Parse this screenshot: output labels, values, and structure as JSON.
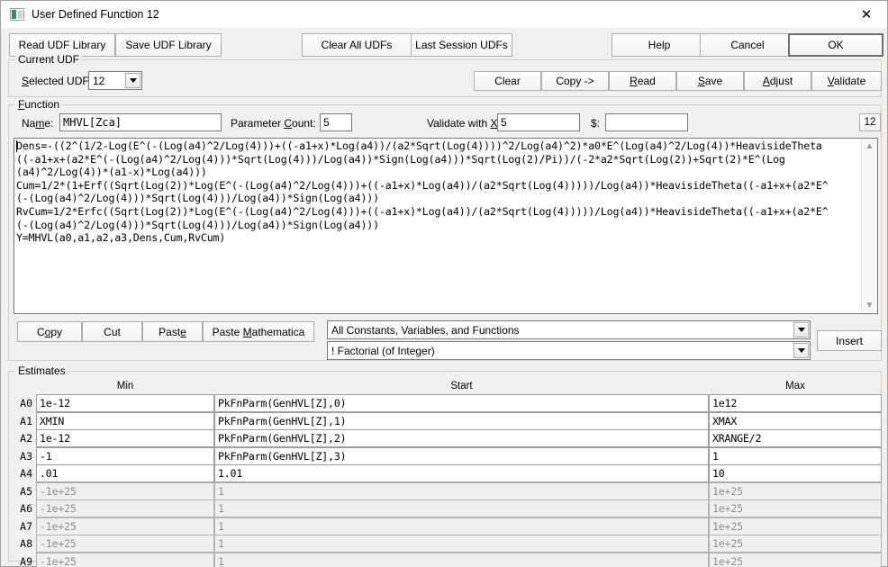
{
  "window": {
    "title": "User Defined Function 12",
    "icon": "app-icon",
    "close_label": "✕"
  },
  "toolbar": {
    "read_udf_library": "Read UDF Library",
    "save_udf_library": "Save UDF Library",
    "clear_all_udfs": "Clear All UDFs",
    "last_session_udfs": "Last Session UDFs",
    "help": "Help",
    "cancel": "Cancel",
    "ok": "OK"
  },
  "current_udf": {
    "legend": "Current UDF",
    "selected_label": "Selected UDF:",
    "selected_value": "12",
    "buttons": {
      "clear": "Clear",
      "copy_to": "Copy ->",
      "read": "Read",
      "save": "Save",
      "adjust": "Adjust",
      "validate": "Validate"
    }
  },
  "function": {
    "legend": "Function",
    "name_label": "Name:",
    "name_value": "MHVL[Zca]",
    "param_count_label": "Parameter Count:",
    "param_count_value": "5",
    "validate_x_label": "Validate with X:",
    "validate_x_value": "5",
    "dollar_label": "$:",
    "dollar_value": "",
    "index_badge": "12",
    "formula_lines": [
      "Dens=-((2^(1/2-Log(E^(-(Log(a4)^2/Log(4)))+((-a1+x)*Log(a4))/(a2*Sqrt(Log(4))))^2/Log(a4)^2)*a0*E^(Log(a4)^2/Log(4))*HeavisideTheta",
      "((-a1+x+(a2*E^(-(Log(a4)^2/Log(4)))*Sqrt(Log(4)))/Log(a4))*Sign(Log(a4)))*Sqrt(Log(2)/Pi))/(-2*a2*Sqrt(Log(2))+Sqrt(2)*E^(Log",
      "(a4)^2/Log(4))*(a1-x)*Log(a4)))",
      "Cum=1/2*(1+Erf((Sqrt(Log(2))*Log(E^(-(Log(a4)^2/Log(4)))+((-a1+x)*Log(a4))/(a2*Sqrt(Log(4)))))/Log(a4))*HeavisideTheta((-a1+x+(a2*E^",
      "(-(Log(a4)^2/Log(4)))*Sqrt(Log(4)))/Log(a4))*Sign(Log(a4)))",
      "RvCum=1/2*Erfc((Sqrt(Log(2))*Log(E^(-(Log(a4)^2/Log(4)))+((-a1+x)*Log(a4))/(a2*Sqrt(Log(4)))))/Log(a4))*HeavisideTheta((-a1+x+(a2*E^",
      "(-(Log(a4)^2/Log(4)))*Sqrt(Log(4)))/Log(a4))*Sign(Log(a4)))",
      "Y=MHVL(a0,a1,a2,a3,Dens,Cum,RvCum)"
    ],
    "edit_buttons": {
      "copy": "Copy",
      "cut": "Cut",
      "paste": "Paste",
      "paste_mathematica": "Paste Mathematica"
    },
    "category_combo": "All Constants, Variables, and Functions",
    "item_combo": "! Factorial (of Integer)",
    "insert": "Insert"
  },
  "estimates": {
    "legend": "Estimates",
    "columns": [
      "Min",
      "Start",
      "Max"
    ],
    "rows": [
      {
        "label": "A0",
        "min": "1e-12",
        "start": "PkFnParm(GenHVL[Z],0)",
        "max": "1e12",
        "enabled": true
      },
      {
        "label": "A1",
        "min": "XMIN",
        "start": "PkFnParm(GenHVL[Z],1)",
        "max": "XMAX",
        "enabled": true
      },
      {
        "label": "A2",
        "min": "1e-12",
        "start": "PkFnParm(GenHVL[Z],2)",
        "max": "XRANGE/2",
        "enabled": true
      },
      {
        "label": "A3",
        "min": "-1",
        "start": "PkFnParm(GenHVL[Z],3)",
        "max": "1",
        "enabled": true
      },
      {
        "label": "A4",
        "min": ".01",
        "start": "1.01",
        "max": "10",
        "enabled": true
      },
      {
        "label": "A5",
        "min": "-1e+25",
        "start": "1",
        "max": "1e+25",
        "enabled": false
      },
      {
        "label": "A6",
        "min": "-1e+25",
        "start": "1",
        "max": "1e+25",
        "enabled": false
      },
      {
        "label": "A7",
        "min": "-1e+25",
        "start": "1",
        "max": "1e+25",
        "enabled": false
      },
      {
        "label": "A8",
        "min": "-1e+25",
        "start": "1",
        "max": "1e+25",
        "enabled": false
      },
      {
        "label": "A9",
        "min": "-1e+25",
        "start": "1",
        "max": "1e+25",
        "enabled": false
      }
    ]
  },
  "colors": {
    "window_bg": "#f0f0f0",
    "field_bg": "#ffffff",
    "disabled_text": "#8e8e8e",
    "border": "#adadad"
  }
}
